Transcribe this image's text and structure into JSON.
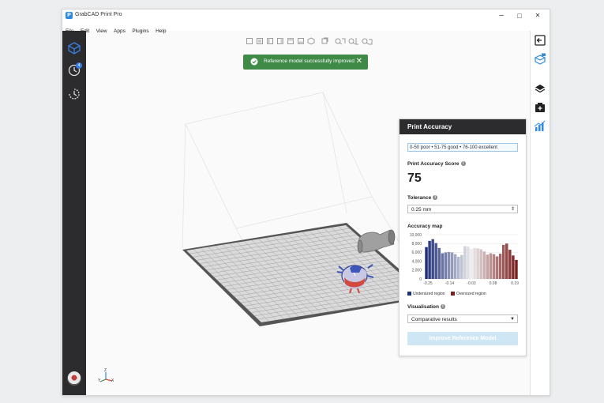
{
  "app": {
    "title": "GrabCAD Print Pro",
    "logo_letter": "P",
    "accent": "#2e8be0"
  },
  "window_controls": {
    "minimize": "–",
    "maximize": "□",
    "close": "✕"
  },
  "menu": [
    "File",
    "Edit",
    "View",
    "Apps",
    "Plugins",
    "Help"
  ],
  "left_sidebar": {
    "icons": [
      "model-view-icon",
      "history-icon",
      "timeline-icon"
    ],
    "badge": "4"
  },
  "right_sidebar": {
    "icons": [
      "collapse-panel-icon",
      "print-settings-icon",
      "layers-icon",
      "add-tray-icon",
      "accuracy-chart-icon"
    ]
  },
  "toast": {
    "message": "Reference model successfully improved",
    "close": "✕",
    "color": "#3f8a47"
  },
  "panel": {
    "title": "Print Accuracy",
    "legend": "0-50 poor  •  51-75 good  •  76-100 excellent",
    "score_label": "Print Accuracy Score",
    "score": "75",
    "tolerance_label": "Tolerance",
    "tolerance_value": "0.25 mm",
    "accuracy_map_label": "Accuracy map",
    "visualisation_label": "Visualisation",
    "visualisation_value": "Comparative results",
    "button_label": "Improve Reference Model"
  },
  "chart_data": {
    "type": "bar",
    "ylim": [
      0,
      10000
    ],
    "yticks": [
      "10,000",
      "8,000",
      "6,000",
      "4,000",
      "2,000",
      "0"
    ],
    "xtick_labels": [
      "-0.25",
      "-0.14",
      "-0.03",
      "0.08",
      "0.19"
    ],
    "x": [
      -0.25,
      -0.23,
      -0.21,
      -0.19,
      -0.17,
      -0.15,
      -0.13,
      -0.11,
      -0.09,
      -0.07,
      -0.05,
      -0.03,
      -0.01,
      0.01,
      0.03,
      0.05,
      0.07,
      0.09,
      0.11,
      0.13,
      0.15,
      0.17,
      0.19,
      0.21,
      0.23,
      0.25
    ],
    "values": [
      7200,
      8600,
      9000,
      8100,
      7000,
      5800,
      6000,
      6100,
      6000,
      5600,
      5000,
      5400,
      7400,
      7300,
      6800,
      7000,
      6900,
      6700,
      6200,
      5500,
      5800,
      5600,
      5100,
      5700,
      7700,
      8000,
      6600,
      5300,
      4300
    ],
    "series": [
      {
        "name": "Undersized region",
        "color": "#1f2f78"
      },
      {
        "name": "Oversized region",
        "color": "#7a1e1e"
      }
    ],
    "grid": true
  },
  "axis_triad": {
    "x": "X",
    "y": "Y",
    "z": "Z"
  }
}
